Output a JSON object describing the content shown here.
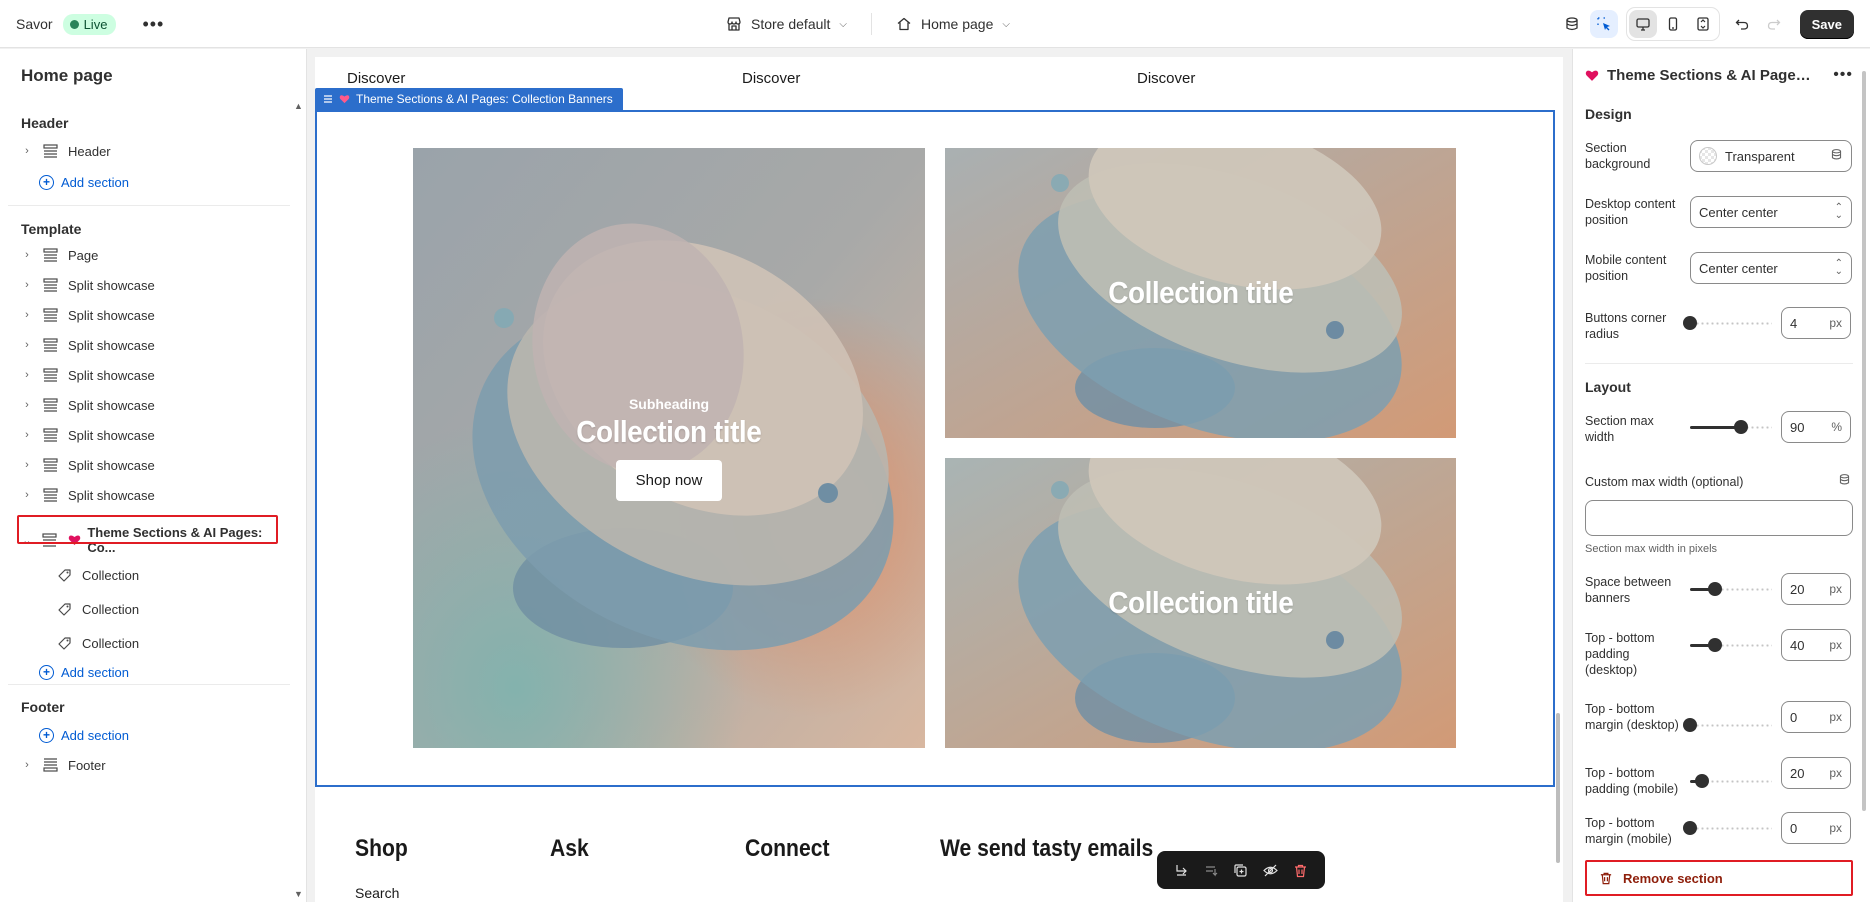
{
  "topbar": {
    "app_name": "Savor",
    "status": "Live",
    "store_select": "Store default",
    "page_select": "Home page",
    "save_label": "Save"
  },
  "sidebar": {
    "title": "Home page",
    "groups": {
      "header": {
        "title": "Header",
        "items": [
          "Header"
        ],
        "add": "Add section"
      },
      "template": {
        "title": "Template",
        "items": [
          "Page",
          "Split showcase",
          "Split showcase",
          "Split showcase",
          "Split showcase",
          "Split showcase",
          "Split showcase",
          "Split showcase",
          "Split showcase"
        ],
        "selected": "Theme Sections & AI Pages: Co...",
        "children": [
          "Collection",
          "Collection",
          "Collection"
        ],
        "add": "Add section"
      },
      "footer": {
        "title": "Footer",
        "add": "Add section",
        "items": [
          "Footer"
        ]
      }
    }
  },
  "preview": {
    "nav": [
      "Discover",
      "Discover",
      "Discover"
    ],
    "section_label": "Theme Sections & AI Pages: Collection Banners",
    "banners": [
      {
        "subheading": "Subheading",
        "title": "Collection title",
        "button": "Shop now"
      },
      {
        "title": "Collection title"
      },
      {
        "title": "Collection title"
      }
    ],
    "footer_cols": [
      "Shop",
      "Ask",
      "Connect",
      "We send tasty emails"
    ],
    "footer_link": "Search"
  },
  "settings": {
    "title": "Theme Sections & AI Pages:...",
    "design": {
      "heading": "Design",
      "section_background_label": "Section background",
      "section_background_value": "Transparent",
      "desktop_position_label": "Desktop content position",
      "desktop_position_value": "Center center",
      "mobile_position_label": "Mobile content position",
      "mobile_position_value": "Center center",
      "corner_radius_label": "Buttons corner radius",
      "corner_radius_value": "4",
      "corner_radius_unit": "px"
    },
    "layout": {
      "heading": "Layout",
      "max_width_label": "Section max width",
      "max_width_value": "90",
      "max_width_unit": "%",
      "custom_width_label": "Custom max width (optional)",
      "custom_width_help": "Section max width in pixels",
      "space_label": "Space between banners",
      "space_value": "20",
      "pad_desktop_label": "Top - bottom padding (desktop)",
      "pad_desktop_value": "40",
      "margin_desktop_label": "Top - bottom margin (desktop)",
      "margin_desktop_value": "0",
      "pad_mobile_label": "Top - bottom padding (mobile)",
      "pad_mobile_value": "20",
      "margin_mobile_label": "Top - bottom margin (mobile)",
      "margin_mobile_value": "0",
      "unit_px": "px"
    },
    "remove_label": "Remove section"
  },
  "sliders": {
    "corner_radius": 0.0,
    "max_width": 0.62,
    "space": 0.3,
    "pad_desktop": 0.3,
    "margin_desktop": 0.0,
    "pad_mobile": 0.15,
    "margin_mobile": 0.0
  },
  "colors": {
    "accent": "#2c6ecb",
    "highlight": "#e01c24",
    "live": "#29845a",
    "heart": "#e0115f"
  }
}
